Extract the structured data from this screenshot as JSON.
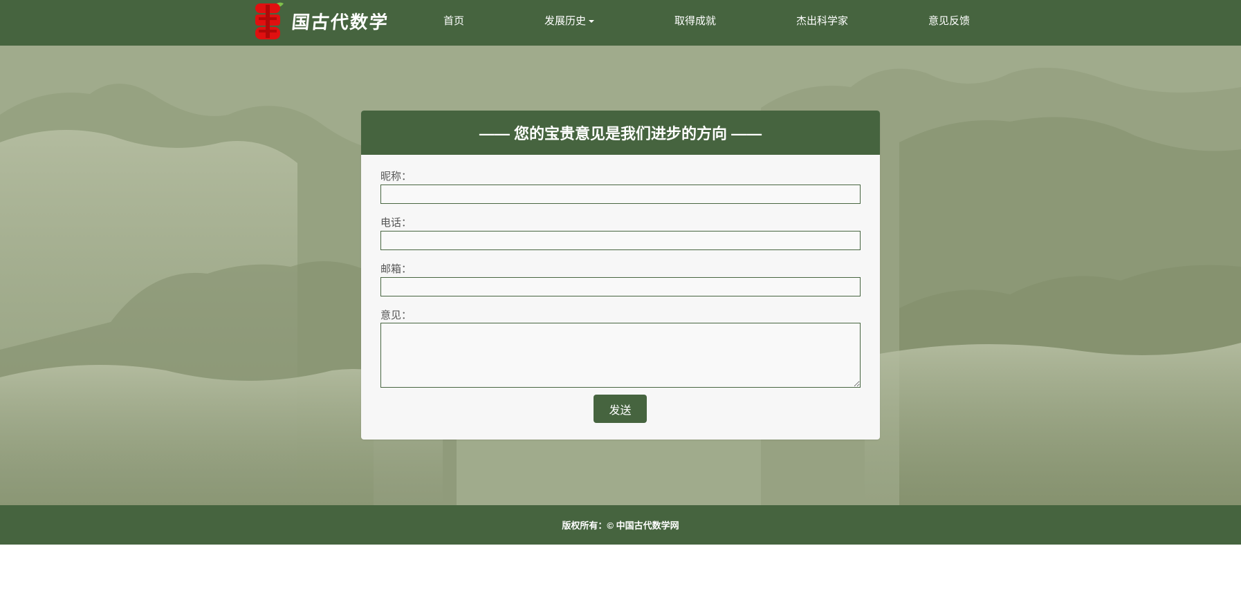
{
  "header": {
    "logo_text": "国古代数学",
    "nav": [
      {
        "label": "首页"
      },
      {
        "label": "发展历史"
      },
      {
        "label": "取得成就"
      },
      {
        "label": "杰出科学家"
      },
      {
        "label": "意见反馈"
      }
    ]
  },
  "form": {
    "title": "—— 您的宝贵意见是我们进步的方向 ——",
    "fields": [
      {
        "label": "昵称：",
        "value": ""
      },
      {
        "label": "电话：",
        "value": ""
      },
      {
        "label": "邮箱：",
        "value": ""
      },
      {
        "label": "意见：",
        "value": ""
      }
    ],
    "submit_label": "发送"
  },
  "footer": {
    "copyright": "版权所有：© 中国古代数学网"
  },
  "colors": {
    "primary": "#46643f",
    "background": "#a0ab8c",
    "logo_seal": "#e01010"
  }
}
